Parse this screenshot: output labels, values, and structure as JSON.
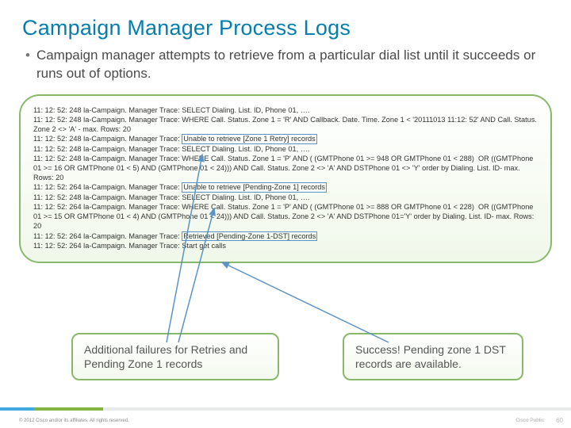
{
  "header": {
    "title": "Campaign Manager Process Logs"
  },
  "bullet": {
    "mark": "•",
    "text": "Campaign manager attempts to retrieve from a particular dial list until it succeeds or runs out of options."
  },
  "log_lines": [
    "11: 12: 52: 248 la-Campaign. Manager Trace: SELECT Dialing. List. ID, Phone 01, ….",
    "11: 12: 52: 248 la-Campaign. Manager Trace: WHERE Call. Status. Zone 1 = 'R' AND Callback. Date. Time. Zone 1 < '20111013 11:12: 52' AND Call. Status. Zone 2 <> 'A' - max. Rows: 20",
    "11: 12: 52: 248 la-Campaign. Manager Trace: [[HL]]Unable to retrieve [Zone 1 Retry] records[[/HL]]",
    "11: 12: 52: 248 la-Campaign. Manager Trace: SELECT Dialing. List. ID, Phone 01, ….",
    "11: 12: 52: 248 la-Campaign. Manager Trace: WHERE Call. Status. Zone 1 = 'P' AND ( (GMTPhone 01 >= 948 OR GMTPhone 01 < 288)  OR ((GMTPhone 01 >= 16 OR GMTPhone 01 < 5) AND (GMTPhone 01 < 24))) AND Call. Status. Zone 2 <> 'A' AND DSTPhone 01 <> 'Y' order by Dialing. List. ID- max. Rows: 20",
    "11: 12: 52: 264 la-Campaign. Manager Trace: [[HL]]Unable to retrieve [Pending-Zone 1] records[[/HL]]",
    "11: 12: 52: 248 la-Campaign. Manager Trace: SELECT Dialing. List. ID, Phone 01, ….",
    "11: 12: 52: 264 la-Campaign. Manager Trace: WHERE Call. Status. Zone 1 = 'P' AND ( (GMTPhone 01 >= 888 OR GMTPhone 01 < 228)  OR ((GMTPhone 01 >= 15 OR GMTPhone 01 < 4) AND (GMTPhone 01 < 24))) AND Call. Status. Zone 2 <> 'A' AND DSTPhone 01='Y' order by Dialing. List. ID- max. Rows: 20",
    "11: 12: 52: 264 la-Campaign. Manager Trace: [[HL]]Retrieved [Pending-Zone 1-DST] records[[/HL]]",
    "11: 12: 52: 264 la-Campaign. Manager Trace: Start get calls"
  ],
  "callouts": {
    "left": "Additional failures for Retries and Pending Zone 1 records",
    "right": "Success! Pending zone 1 DST records are available."
  },
  "footer": {
    "copyright": "© 2012 Cisco and/or its affiliates. All rights reserved.",
    "public": "Cisco Public",
    "page": "60"
  }
}
